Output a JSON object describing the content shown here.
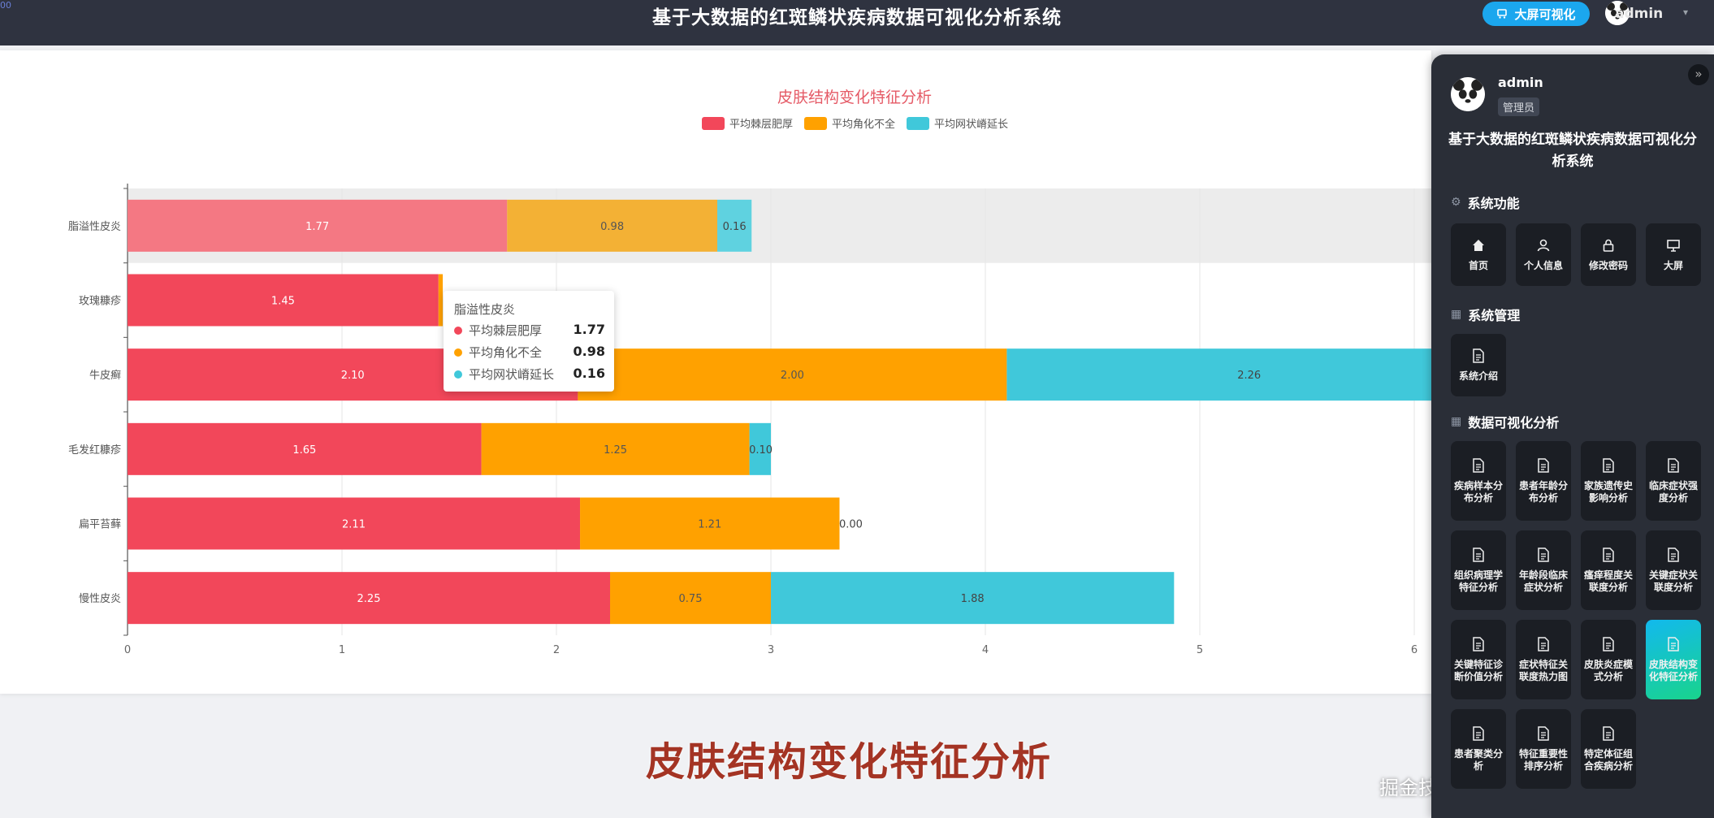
{
  "header": {
    "title": "基于大数据的红斑鳞状疾病数据可视化分析系统",
    "bigscreen_label": "大屏可视化",
    "user": "admin",
    "corner_mark": "00"
  },
  "tooltip": {
    "title": "脂溢性皮炎",
    "rows": [
      {
        "name": "平均棘层肥厚",
        "value": "1.77"
      },
      {
        "name": "平均角化不全",
        "value": "0.98"
      },
      {
        "name": "平均网状嵴延长",
        "value": "0.16"
      }
    ]
  },
  "chart_data": {
    "type": "bar",
    "orientation": "horizontal",
    "stacked": true,
    "title": "皮肤结构变化特征分析",
    "categories": [
      "脂溢性皮炎",
      "玫瑰糠疹",
      "牛皮癣",
      "毛发红糠疹",
      "扁平苔藓",
      "慢性皮炎"
    ],
    "series": [
      {
        "name": "平均棘层肥厚",
        "color": "#f2475a",
        "values": [
          1.77,
          1.45,
          2.1,
          1.65,
          2.11,
          2.25
        ],
        "labels": [
          "1.77",
          "1.45",
          "2.10",
          "1.65",
          "2.11",
          "2.25"
        ]
      },
      {
        "name": "平均角化不全",
        "color": "#ffa100",
        "values": [
          0.98,
          0.02,
          2.0,
          1.25,
          1.21,
          0.75
        ],
        "labels": [
          "0.98",
          "",
          "2.00",
          "1.25",
          "1.21",
          "0.75"
        ]
      },
      {
        "name": "平均网状嵴延长",
        "color": "#40c8da",
        "values": [
          0.16,
          0.0,
          2.26,
          0.1,
          0.0,
          1.88
        ],
        "labels": [
          "0.16",
          "",
          "2.26",
          "0.10",
          "0.00",
          "1.88"
        ]
      }
    ],
    "x_ticks": [
      "0",
      "1",
      "2",
      "3",
      "4",
      "5",
      "6"
    ],
    "xlim": [
      0,
      6.3
    ],
    "highlighted_category": "脂溢性皮炎",
    "legend_position": "top-center",
    "grid": true
  },
  "caption": "皮肤结构变化特征分析",
  "watermark": "掘金技术社区 @ 计算机编程指导师",
  "sidebar": {
    "user": "admin",
    "role": "管理员",
    "title": "基于大数据的红斑鳞状疾病数据可视化分析系统",
    "sections": [
      {
        "title": "系统功能",
        "items": [
          {
            "label": "首页",
            "icon": "home-icon"
          },
          {
            "label": "个人信息",
            "icon": "user-icon"
          },
          {
            "label": "修改密码",
            "icon": "lock-icon"
          },
          {
            "label": "大屏",
            "icon": "presentation-icon"
          }
        ]
      },
      {
        "title": "系统管理",
        "items": [
          {
            "label": "系统介绍",
            "icon": "document-icon"
          }
        ]
      },
      {
        "title": "数据可视化分析",
        "items": [
          {
            "label": "疾病样本分布分析",
            "icon": "document-icon"
          },
          {
            "label": "患者年龄分布分析",
            "icon": "document-icon"
          },
          {
            "label": "家族遗传史影响分析",
            "icon": "document-icon"
          },
          {
            "label": "临床症状强度分析",
            "icon": "document-icon"
          },
          {
            "label": "组织病理学特征分析",
            "icon": "document-icon"
          },
          {
            "label": "年龄段临床症状分析",
            "icon": "document-icon"
          },
          {
            "label": "瘙痒程度关联度分析",
            "icon": "document-icon"
          },
          {
            "label": "关键症状关联度分析",
            "icon": "document-icon"
          },
          {
            "label": "关键特征诊断价值分析",
            "icon": "document-icon"
          },
          {
            "label": "症状特征关联度热力图",
            "icon": "document-icon"
          },
          {
            "label": "皮肤炎症模式分析",
            "icon": "document-icon"
          },
          {
            "label": "皮肤结构变化特征分析",
            "icon": "document-icon",
            "active": true
          },
          {
            "label": "患者聚类分析",
            "icon": "document-icon"
          },
          {
            "label": "特征重要性排序分析",
            "icon": "document-icon"
          },
          {
            "label": "特定体征组合疾病分析",
            "icon": "document-icon"
          }
        ]
      }
    ]
  }
}
